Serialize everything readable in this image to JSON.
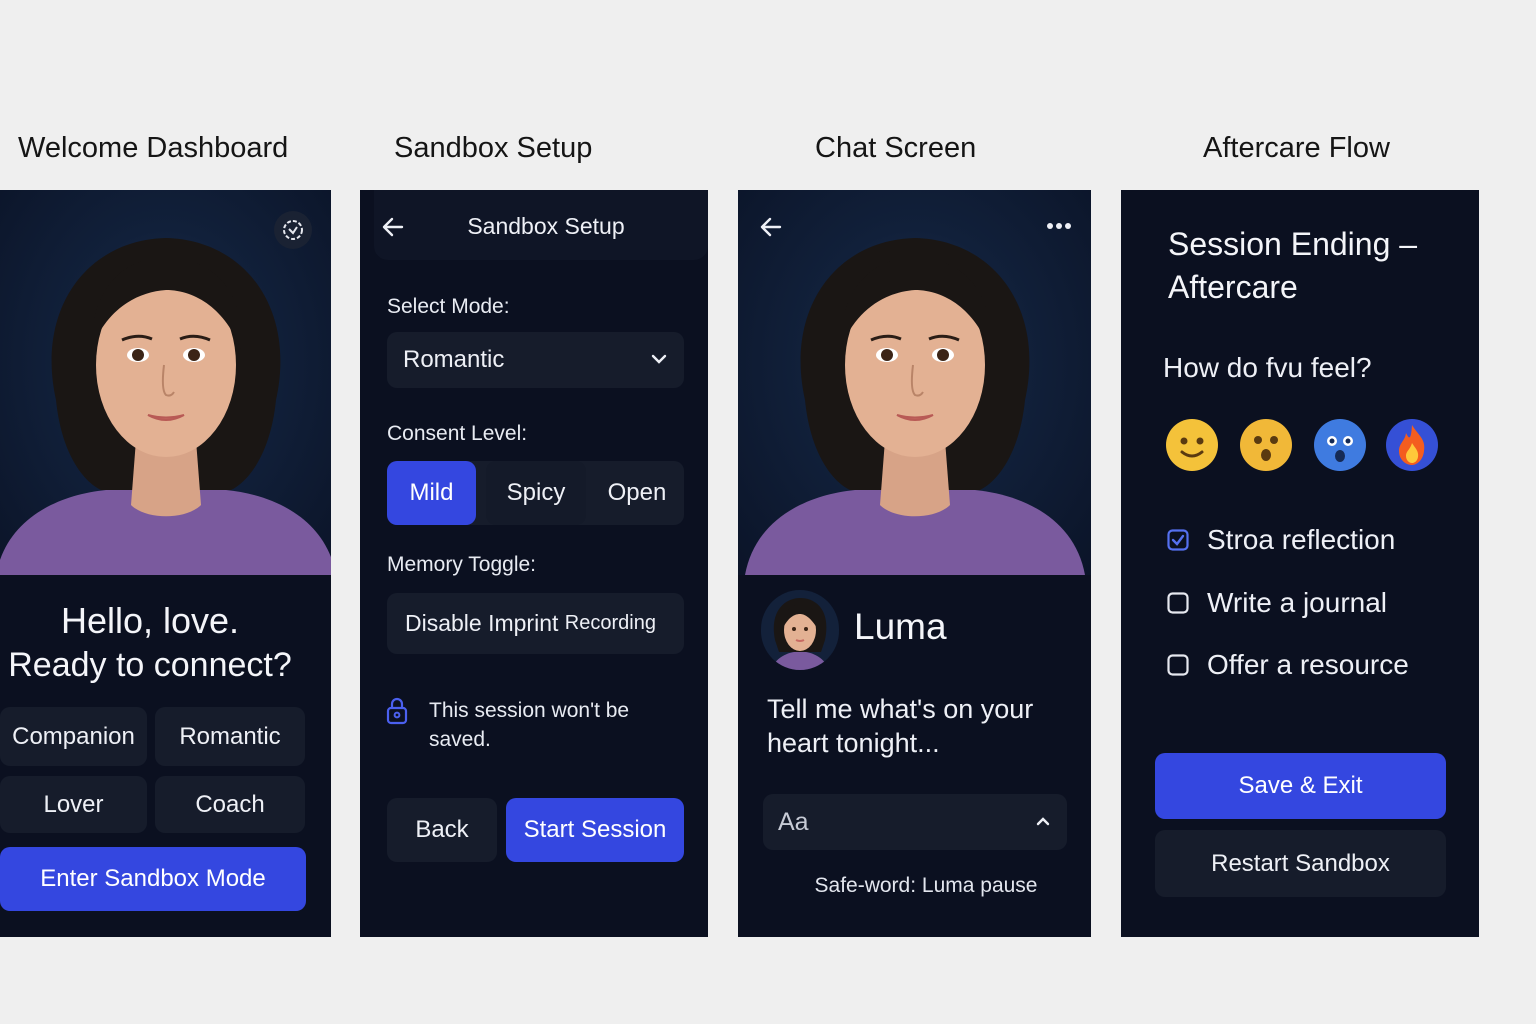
{
  "titles": {
    "welcome": "Welcome Dashboard",
    "sandbox": "Sandbox Setup",
    "chat": "Chat Screen",
    "aftercare": "Aftercare Flow"
  },
  "welcome": {
    "greeting_line1": "Hello, love.",
    "greeting_line2": "Ready to connect?",
    "roles": [
      "Companion",
      "Romantic",
      "Lover",
      "Coach"
    ],
    "enter_button": "Enter Sandbox Mode",
    "settings_icon": "settings-badge-icon"
  },
  "sandbox": {
    "header_title": "Sandbox Setup",
    "back_icon": "arrow-left-icon",
    "select_mode_label": "Select Mode:",
    "mode_value": "Romantic",
    "consent_label": "Consent Level:",
    "consent_options": [
      "Mild",
      "Spicy",
      "Open"
    ],
    "consent_selected": "Mild",
    "memory_label": "Memory Toggle:",
    "memory_button_main": "Disable Imprint",
    "memory_button_tail": "Recording",
    "notice_line1": "This session won't be",
    "notice_line2": "saved.",
    "back_button": "Back",
    "start_button": "Start Session",
    "lock_icon": "lock-icon"
  },
  "chat": {
    "name": "Luma",
    "message_line1": "Tell me what's on your",
    "message_line2": "heart tonight...",
    "input_placeholder": "Aa",
    "safe_word": "Safe-word: Luma pause",
    "more_icon": "more-horizontal-icon"
  },
  "aftercare": {
    "title_line1": "Session Ending –",
    "title_line2": "Aftercare",
    "question": "How do fvu feel?",
    "moods": [
      "smiling-face-icon",
      "surprised-face-icon",
      "astonished-face-icon",
      "fire-icon"
    ],
    "options": [
      {
        "label": "Stroa reflection",
        "checked": true
      },
      {
        "label": "Write a journal",
        "checked": false
      },
      {
        "label": "Offer a resource",
        "checked": false
      }
    ],
    "save_button": "Save & Exit",
    "restart_button": "Restart Sandbox"
  },
  "colors": {
    "panel_bg": "#0b1020",
    "accent": "#3447e0",
    "control_bg": "#161c2b"
  }
}
